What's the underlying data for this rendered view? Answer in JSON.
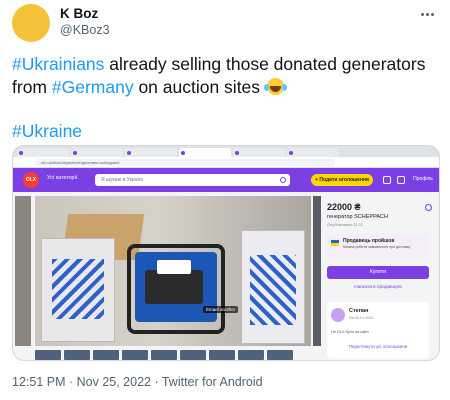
{
  "author": {
    "name": "K Boz",
    "handle": "@KBoz3"
  },
  "tweet": {
    "hashtag_1": "#Ukrainians",
    "text_1": " already selling those donated generators",
    "text_2": "from ",
    "hashtag_2": "#Germany",
    "text_3": " on auction sites",
    "hashtag_3": "#Ukraine"
  },
  "icons": {
    "more": "more-dots-icon",
    "emoji": "face-with-tears-of-joy-icon"
  },
  "colors": {
    "link": "#1d9bf0",
    "site_accent": "#7b3fe4",
    "cta": "#ffd400"
  },
  "screenshot": {
    "url": "olx.ua/d/uk/obyavlenie/generator-scheppach",
    "site_logo": "OLX",
    "catalog_label": "Усі категорії",
    "search_placeholder": "Я шукаю в Україні",
    "add_listing_label": "+ Подати оголошення",
    "login_label": "Профіль",
    "photo_caption": "Emael another",
    "price": "22000 ₴",
    "title": "генератор SCHEPPACH",
    "posted": "Опубліковано 11:11",
    "verify_title": "Продавець пройшов",
    "verify_desc": "Можна робити замовлення при доставці",
    "buy_label": "Купити",
    "message_label": "Написати продавцеві",
    "seller_name": "Степан",
    "seller_meta": "На OLX з 2022",
    "seller_status": "Не OLX було на сайті",
    "seller_link": "Переглянути усі оголошення"
  },
  "footer": {
    "meta": "12:51 PM · Nov 25, 2022 · Twitter for Android"
  }
}
